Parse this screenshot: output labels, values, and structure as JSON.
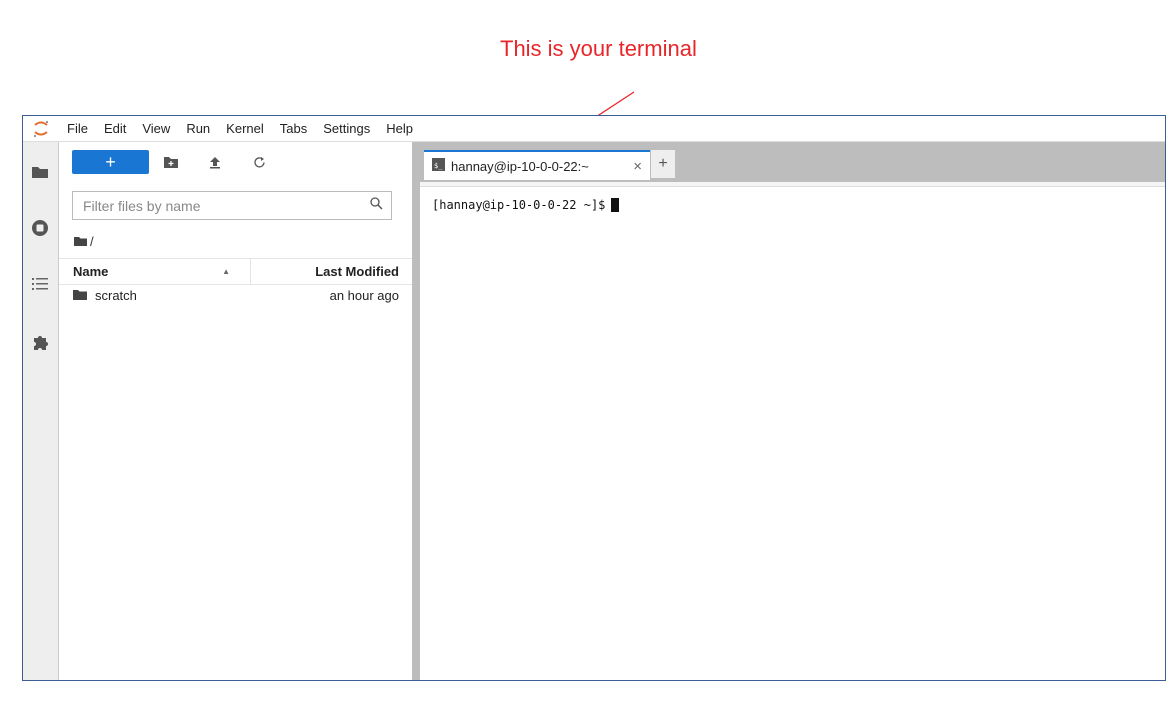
{
  "annotation": {
    "text": "This is your terminal",
    "color": "#e8262a"
  },
  "menubar": {
    "items": [
      "File",
      "Edit",
      "View",
      "Run",
      "Kernel",
      "Tabs",
      "Settings",
      "Help"
    ]
  },
  "left_sidebar": {
    "icons": [
      "folder-icon",
      "running-icon",
      "toc-icon",
      "extension-icon"
    ]
  },
  "file_browser": {
    "new_label": "+",
    "filter_placeholder": "Filter files by name",
    "breadcrumb": "/",
    "columns": {
      "name": "Name",
      "modified": "Last Modified"
    },
    "files": [
      {
        "name": "scratch",
        "type": "folder",
        "modified": "an hour ago"
      }
    ]
  },
  "tabs": [
    {
      "label": "hannay@ip-10-0-0-22:~",
      "close": "×"
    }
  ],
  "add_tab_label": "+",
  "terminal": {
    "prompt": "[hannay@ip-10-0-0-22 ~]$"
  },
  "colors": {
    "accent": "#1976d2",
    "frame": "#3b5f94"
  }
}
